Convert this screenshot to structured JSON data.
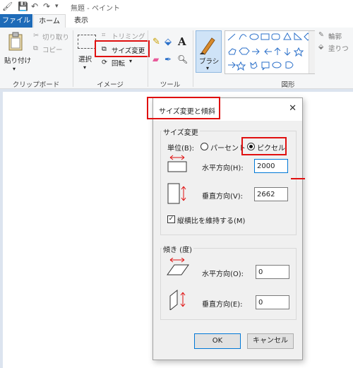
{
  "app": {
    "title": "無題 - ペイント"
  },
  "tabs": {
    "file": "ファイル",
    "home": "ホーム",
    "view": "表示"
  },
  "ribbon": {
    "clipboard": {
      "paste": "貼り付け",
      "cut": "切り取り",
      "copy": "コピー",
      "group": "クリップボード"
    },
    "image": {
      "select": "選択",
      "crop": "トリミング",
      "resize": "サイズ変更",
      "rotate": "回転",
      "group": "イメージ"
    },
    "tools": {
      "group": "ツール"
    },
    "brush": {
      "label": "ブラシ"
    },
    "shapes": {
      "outline": "輪郭",
      "fill": "塗りつ",
      "group": "図形"
    }
  },
  "dialog": {
    "title": "サイズ変更と傾斜",
    "resize": {
      "legend": "サイズ変更",
      "unit_label": "単位(B):",
      "percent": "パーセント",
      "pixel": "ピクセル",
      "horizontal_label": "水平方向(H):",
      "horizontal_value": "2000",
      "vertical_label": "垂直方向(V):",
      "vertical_value": "2662",
      "keep_ratio": "縦横比を維持する(M)",
      "keep_ratio_checked": true,
      "selected_unit": "pixel"
    },
    "skew": {
      "legend": "傾き (度)",
      "horizontal_label": "水平方向(O):",
      "horizontal_value": "0",
      "vertical_label": "垂直方向(E):",
      "vertical_value": "0"
    },
    "ok": "OK",
    "cancel": "キャンセル"
  },
  "colors": {
    "accent": "#1e6bb8",
    "highlight": "#e01010"
  }
}
